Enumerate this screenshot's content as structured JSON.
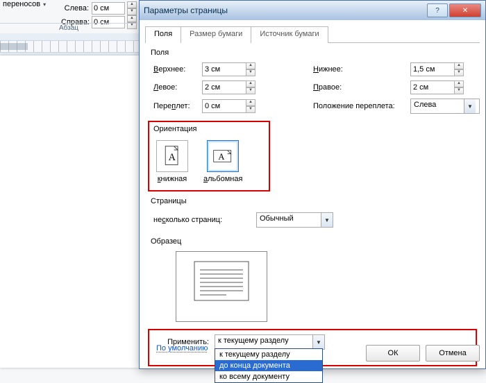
{
  "ribbon": {
    "left_label": "Слева:",
    "right_label": "Справа:",
    "left_value": "0 см",
    "right_value": "0 см",
    "hyphenation": "переносов",
    "group_label": "Абзац"
  },
  "dialog": {
    "title": "Параметры страницы",
    "help_icon": "help-icon",
    "close_icon": "close-icon",
    "tabs": {
      "margins": "Поля",
      "paper": "Размер бумаги",
      "source": "Источник бумаги"
    },
    "margins": {
      "group": "Поля",
      "top": {
        "label": "Верхнее:",
        "value": "3 см"
      },
      "bottom": {
        "label": "Нижнее:",
        "value": "1,5 см"
      },
      "left": {
        "label": "Левое:",
        "value": "2 см"
      },
      "right": {
        "label": "Правое:",
        "value": "2 см"
      },
      "gutter": {
        "label": "Переплет:",
        "value": "0 см"
      },
      "gutter_pos": {
        "label": "Положение переплета:",
        "value": "Слева"
      }
    },
    "orientation": {
      "group": "Ориентация",
      "portrait": "книжная",
      "landscape": "альбомная",
      "selected": "landscape"
    },
    "pages": {
      "group": "Страницы",
      "multi_label": "несколько страниц:",
      "multi_value": "Обычный"
    },
    "preview": {
      "group": "Образец"
    },
    "apply": {
      "label": "Применить:",
      "value": "к текущему разделу",
      "options": [
        "к текущему разделу",
        "до конца документа",
        "ко всему документу"
      ],
      "selected_index": 1
    },
    "defaults": "По умолчанию",
    "buttons": {
      "ok": "ОК",
      "cancel": "Отмена"
    }
  }
}
